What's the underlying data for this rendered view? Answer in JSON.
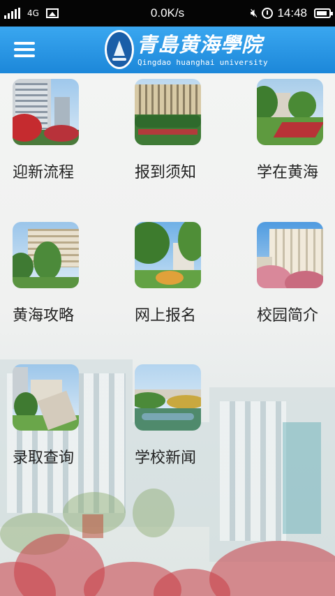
{
  "status_bar": {
    "network": "4G",
    "speed": "0.0K/s",
    "time": "14:48",
    "icons": [
      "signal-icon",
      "image-notification-icon",
      "mute-icon",
      "alarm-icon",
      "battery-icon"
    ]
  },
  "header": {
    "menu_icon": "hamburger-menu-icon",
    "title_cn": "青島黄海學院",
    "title_en": "Qingdao huanghai university"
  },
  "menu": [
    {
      "label": "迎新流程",
      "icon": "campus-photo-1"
    },
    {
      "label": "报到须知",
      "icon": "campus-photo-2"
    },
    {
      "label": "学在黄海",
      "icon": "campus-photo-3"
    },
    {
      "label": "黄海攻略",
      "icon": "campus-photo-4"
    },
    {
      "label": "网上报名",
      "icon": "campus-photo-5"
    },
    {
      "label": "校园简介",
      "icon": "campus-photo-6"
    },
    {
      "label": "录取查询",
      "icon": "campus-photo-7"
    },
    {
      "label": "学校新闻",
      "icon": "campus-photo-8"
    }
  ],
  "colors": {
    "header_blue": "#2196e8",
    "status_bar": "#050505",
    "label_text": "#222222",
    "background": "#f2f3f2"
  }
}
